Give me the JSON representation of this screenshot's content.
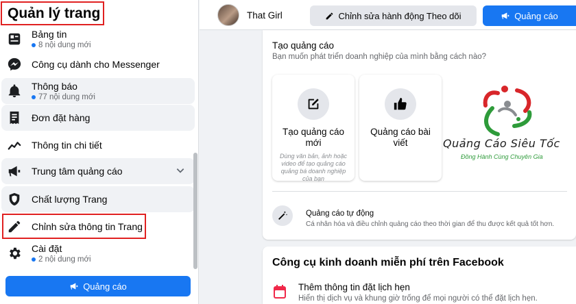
{
  "sidebar": {
    "title": "Quản lý trang",
    "items": [
      {
        "label": "Bảng tin",
        "sub": "8 nội dung mới",
        "icon": "news-feed-icon"
      },
      {
        "label": "Công cụ dành cho Messenger",
        "icon": "messenger-icon"
      },
      {
        "label": "Thông báo",
        "sub": "77 nội dung mới",
        "icon": "bell-icon"
      },
      {
        "label": "Đơn đặt hàng",
        "icon": "orders-icon"
      },
      {
        "label": "Thông tin chi tiết",
        "icon": "insights-icon"
      },
      {
        "label": "Trung tâm quảng cáo",
        "icon": "megaphone-icon"
      },
      {
        "label": "Chất lượng Trang",
        "icon": "shield-icon"
      },
      {
        "label": "Chỉnh sửa thông tin Trang",
        "icon": "pencil-icon"
      },
      {
        "label": "Cài đặt",
        "sub": "2 nội dung mới",
        "icon": "gear-icon"
      }
    ],
    "ads_button": "Quảng cáo"
  },
  "topbar": {
    "page_name": "That Girl",
    "edit_follow_button": "Chỉnh sửa hành động Theo dõi",
    "ads_button": "Quảng cáo"
  },
  "create_ad": {
    "title": "Tạo quảng cáo",
    "subtitle": "Bạn muốn phát triển doanh nghiệp của mình bằng cách nào?",
    "options": [
      {
        "title": "Tạo quảng cáo mới",
        "desc": "Dùng văn bản, ảnh hoặc video để tạo quảng cáo quảng bá doanh nghiệp của bạn",
        "icon": "compose-icon"
      },
      {
        "title": "Quảng cáo bài viết",
        "desc": "",
        "icon": "thumbs-up-icon"
      }
    ],
    "auto": {
      "title": "Quảng cáo tự động",
      "desc": "Cá nhân hóa và điều chỉnh quảng cáo theo thời gian để thu được kết quả tốt hơn."
    }
  },
  "logo": {
    "name": "Quảng Cáo Siêu Tốc",
    "tagline": "Đồng Hành Cùng Chuyên Gia",
    "colors": {
      "red": "#d8262a",
      "green": "#2e9b3a",
      "gray": "#8a8d91"
    }
  },
  "tools": {
    "title": "Công cụ kinh doanh miễn phí trên Facebook",
    "item_title": "Thêm thông tin đặt lịch hẹn",
    "item_desc": "Hiển thị dịch vụ và khung giờ trống để mọi người có thể đặt lịch hẹn."
  },
  "colors": {
    "accent": "#1877f2",
    "highlight": "#e02020",
    "background": "#f0f2f5"
  }
}
